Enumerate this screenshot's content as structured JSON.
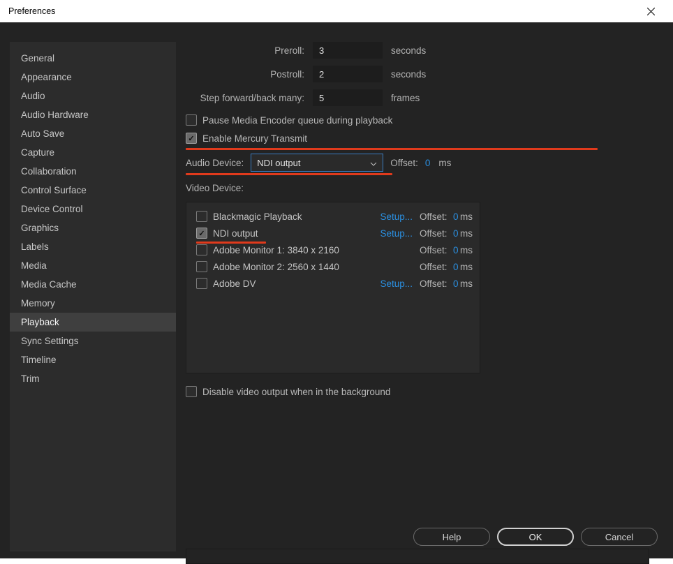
{
  "window": {
    "title": "Preferences"
  },
  "sidebar": {
    "items": [
      {
        "label": "General"
      },
      {
        "label": "Appearance"
      },
      {
        "label": "Audio"
      },
      {
        "label": "Audio Hardware"
      },
      {
        "label": "Auto Save"
      },
      {
        "label": "Capture"
      },
      {
        "label": "Collaboration"
      },
      {
        "label": "Control Surface"
      },
      {
        "label": "Device Control"
      },
      {
        "label": "Graphics"
      },
      {
        "label": "Labels"
      },
      {
        "label": "Media"
      },
      {
        "label": "Media Cache"
      },
      {
        "label": "Memory"
      },
      {
        "label": "Playback"
      },
      {
        "label": "Sync Settings"
      },
      {
        "label": "Timeline"
      },
      {
        "label": "Trim"
      }
    ],
    "selected": "Playback"
  },
  "playback": {
    "preroll": {
      "label": "Preroll:",
      "value": "3",
      "unit": "seconds"
    },
    "postroll": {
      "label": "Postroll:",
      "value": "2",
      "unit": "seconds"
    },
    "step": {
      "label": "Step forward/back many:",
      "value": "5",
      "unit": "frames"
    },
    "pause_encoder": {
      "label": "Pause Media Encoder queue during playback",
      "checked": false
    },
    "mercury": {
      "label": "Enable Mercury Transmit",
      "checked": true
    },
    "audio_device": {
      "label": "Audio Device:",
      "selected": "NDI output",
      "offset_label": "Offset:",
      "offset_value": "0",
      "offset_unit": "ms"
    },
    "video_device_label": "Video Device:",
    "video_devices": [
      {
        "name": "Blackmagic Playback",
        "checked": false,
        "setup": "Setup...",
        "offset_label": "Offset:",
        "offset": "0",
        "ms": "ms"
      },
      {
        "name": "NDI output",
        "checked": true,
        "setup": "Setup...",
        "offset_label": "Offset:",
        "offset": "0",
        "ms": "ms"
      },
      {
        "name": "Adobe Monitor 1: 3840 x 2160",
        "checked": false,
        "setup": "",
        "offset_label": "Offset:",
        "offset": "0",
        "ms": "ms"
      },
      {
        "name": "Adobe Monitor 2: 2560 x 1440",
        "checked": false,
        "setup": "",
        "offset_label": "Offset:",
        "offset": "0",
        "ms": "ms"
      },
      {
        "name": "Adobe DV",
        "checked": false,
        "setup": "Setup...",
        "offset_label": "Offset:",
        "offset": "0",
        "ms": "ms"
      }
    ],
    "disable_bg": {
      "label": "Disable video output when in the background",
      "checked": false
    }
  },
  "footer": {
    "help": "Help",
    "ok": "OK",
    "cancel": "Cancel"
  }
}
